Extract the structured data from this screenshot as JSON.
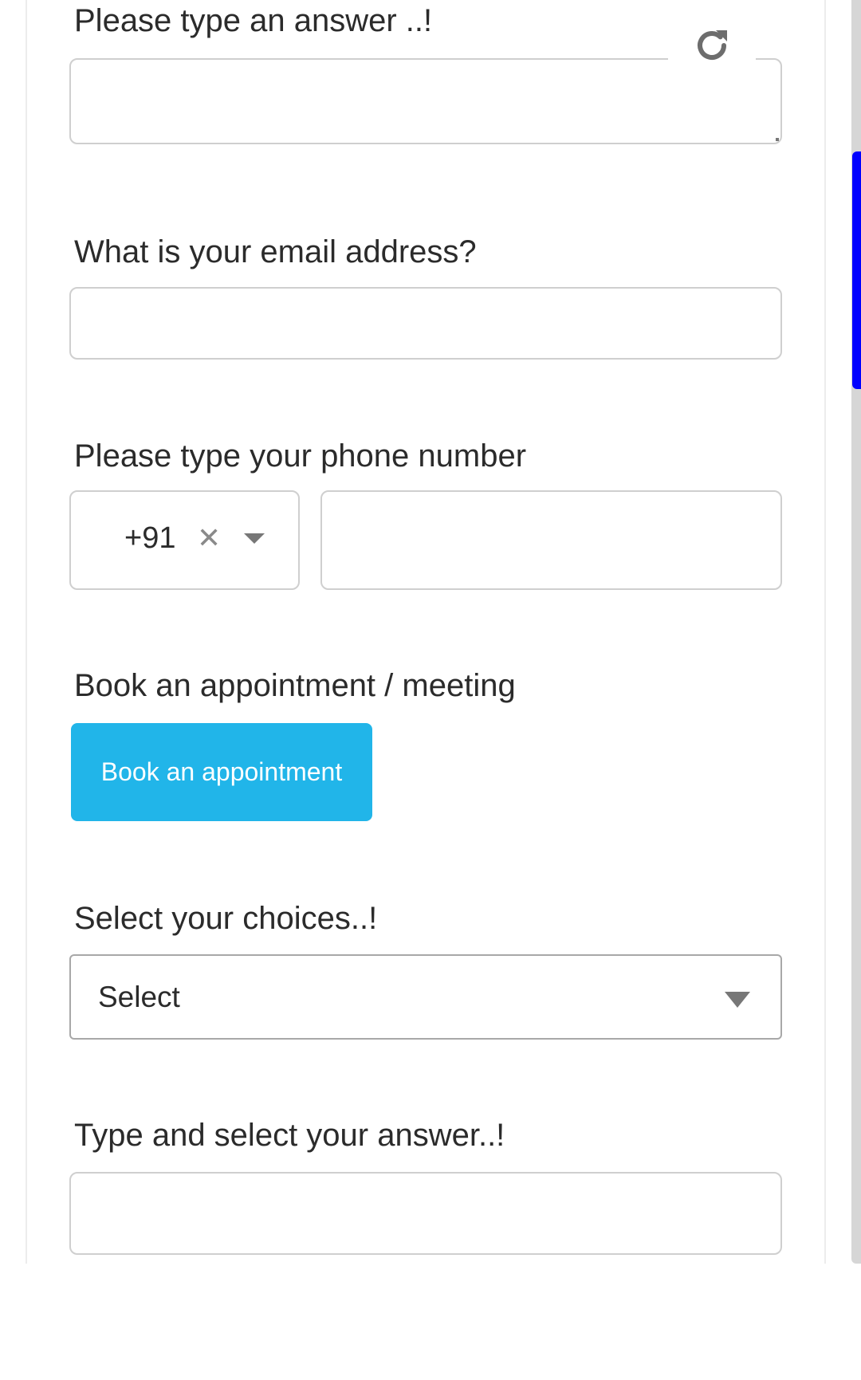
{
  "form": {
    "q_answer": {
      "label": "Please type an answer ..!",
      "value": ""
    },
    "q_email": {
      "label": "What is your email address?",
      "value": ""
    },
    "q_phone": {
      "label": "Please type your phone number",
      "country_code": "+91",
      "clear_glyph": "✕",
      "value": ""
    },
    "q_appointment": {
      "label": "Book an appointment / meeting",
      "button_label": "Book an appointment",
      "button_color": "#21b5e9"
    },
    "q_choices": {
      "label": "Select your choices..!",
      "selected": "Select"
    },
    "q_typeahead": {
      "label": "Type and select your answer..!",
      "value": ""
    }
  },
  "icons": {
    "refresh": "refresh-icon",
    "clear": "close-icon",
    "dropdown": "chevron-down-icon"
  },
  "scrollbar": {
    "thumb_color": "#0000ff"
  }
}
